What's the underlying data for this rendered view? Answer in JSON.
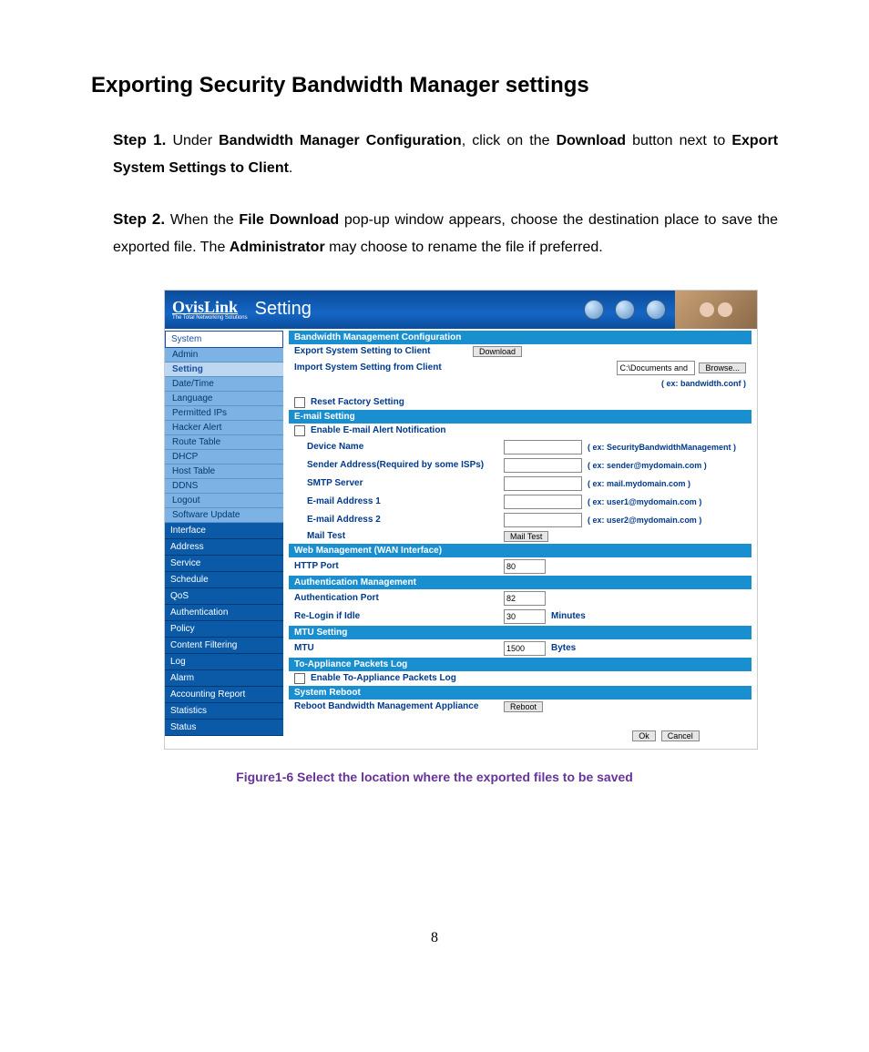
{
  "doc": {
    "title": "Exporting Security Bandwidth Manager settings",
    "step1_label": "Step 1.",
    "step1_t1": "Under ",
    "step1_b1": "Bandwidth Manager Configuration",
    "step1_t2": ", click on the ",
    "step1_b2": "Download",
    "step1_t3": " button next to ",
    "step1_b3": "Export System Settings to Client",
    "step1_t4": ".",
    "step2_label": "Step 2.",
    "step2_t1": "When the ",
    "step2_b1": "File Download",
    "step2_t2": " pop-up window appears, choose the destination place to save the exported file.   The ",
    "step2_b2": "Administrator",
    "step2_t3": " may choose to rename the file if preferred.",
    "figure_caption": "Figure1-6 Select the location where the exported files to be saved",
    "page_number": "8"
  },
  "banner": {
    "logo": "OvisLink",
    "logo_sub": "The Total Networking Solutions",
    "title": "Setting"
  },
  "sidebar": {
    "section_system": "System",
    "items_system": [
      "Admin",
      "Setting",
      "Date/Time",
      "Language",
      "Permitted IPs",
      "Hacker Alert",
      "Route Table",
      "DHCP",
      "Host Table",
      "DDNS",
      "Logout",
      "Software Update"
    ],
    "sections_other": [
      "Interface",
      "Address",
      "Service",
      "Schedule",
      "QoS",
      "Authentication",
      "Policy",
      "Content Filtering",
      "Log",
      "Alarm",
      "Accounting Report",
      "Statistics",
      "Status"
    ]
  },
  "main": {
    "sec_bw": "Bandwidth Management Configuration",
    "export_label": "Export System Setting to Client",
    "download_btn": "Download",
    "import_label": "Import System Setting from Client",
    "import_value": "C:\\Documents and",
    "browse_btn": "Browse...",
    "import_hint": "( ex: bandwidth.conf )",
    "reset_label": "Reset Factory Setting",
    "sec_email": "E-mail Setting",
    "enable_email": "Enable E-mail Alert Notification",
    "device_name": "Device Name",
    "device_hint": "( ex: SecurityBandwidthManagement )",
    "sender_addr": "Sender Address(Required by some ISPs)",
    "sender_hint": "( ex: sender@mydomain.com )",
    "smtp": "SMTP Server",
    "smtp_hint": "( ex: mail.mydomain.com )",
    "email1": "E-mail Address 1",
    "email1_hint": "( ex: user1@mydomain.com )",
    "email2": "E-mail Address 2",
    "email2_hint": "( ex: user2@mydomain.com )",
    "mail_test": "Mail Test",
    "mail_test_btn": "Mail Test",
    "sec_web": "Web Management (WAN Interface)",
    "http_port": "HTTP Port",
    "http_port_val": "80",
    "sec_auth": "Authentication Management",
    "auth_port": "Authentication Port",
    "auth_port_val": "82",
    "relogin": "Re-Login if Idle",
    "relogin_val": "30",
    "minutes": "Minutes",
    "sec_mtu": "MTU Setting",
    "mtu": "MTU",
    "mtu_val": "1500",
    "bytes": "Bytes",
    "sec_pkts": "To-Appliance Packets Log",
    "enable_pkts": "Enable To-Appliance Packets Log",
    "sec_reboot": "System Reboot",
    "reboot_label": "Reboot Bandwidth Management Appliance",
    "reboot_btn": "Reboot",
    "ok_btn": "Ok",
    "cancel_btn": "Cancel"
  }
}
